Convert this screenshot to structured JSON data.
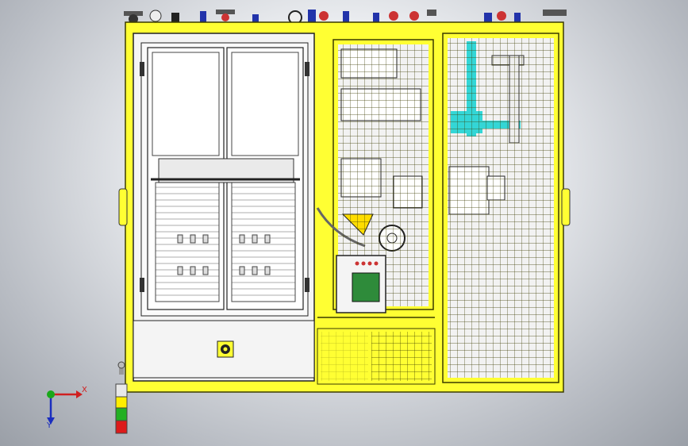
{
  "viewport": {
    "background_top": "#ffffff",
    "background_bottom": "#9a9fa7"
  },
  "colors": {
    "frame_yellow": "#ffff33",
    "frame_outline": "#3a3a00",
    "cabinet_white": "#f4f4f4",
    "line_dark": "#222222",
    "piping_cyan": "#33d6d6",
    "screen_green": "#2e8b3a",
    "tower_light_yellow": "#ffee00",
    "tower_light_green": "#22b022",
    "tower_light_red": "#dd1a1a",
    "axis_x": "#d02020",
    "axis_y": "#1a2dbf",
    "axis_origin": "#1aa81a"
  },
  "axis_triad": {
    "x_label": "X",
    "y_label": "Y"
  },
  "stack_light": {
    "segments": [
      "yellow",
      "green",
      "red"
    ]
  }
}
